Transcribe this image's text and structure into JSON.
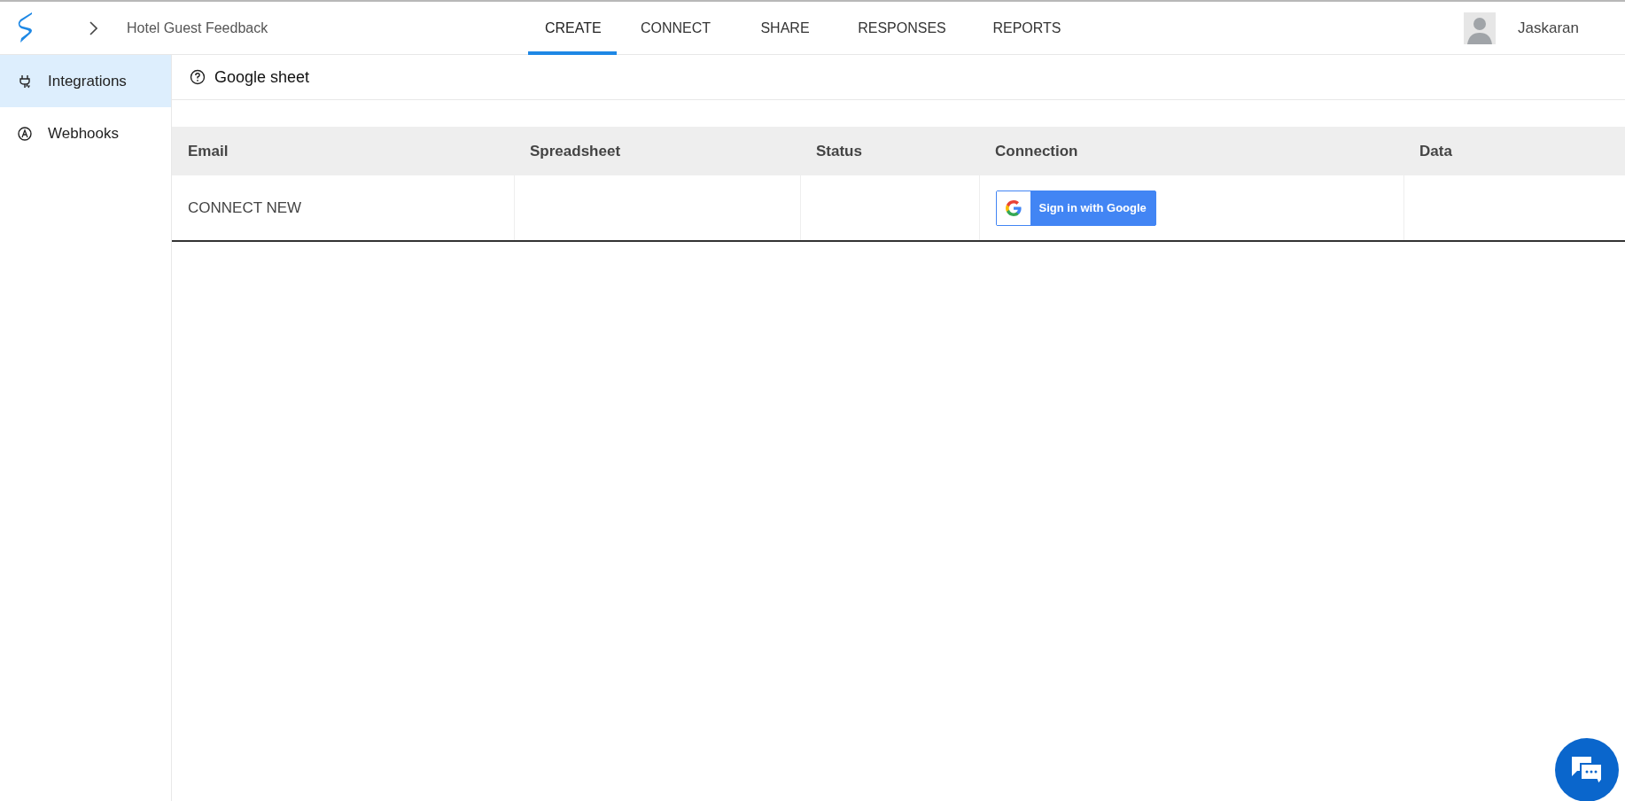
{
  "header": {
    "form_title": "Hotel Guest Feedback",
    "tabs": [
      {
        "label": "CREATE",
        "selected": true
      },
      {
        "label": "CONNECT",
        "selected": false
      },
      {
        "label": "SHARE",
        "selected": false
      },
      {
        "label": "RESPONSES",
        "selected": false
      },
      {
        "label": "REPORTS",
        "selected": false
      }
    ],
    "user_name": "Jaskaran"
  },
  "sidebar": {
    "items": [
      {
        "label": "Integrations",
        "kind": "plug",
        "selected": true
      },
      {
        "label": "Webhooks",
        "kind": "webhook",
        "selected": false
      }
    ]
  },
  "section_title": "Google sheet",
  "table": {
    "columns": [
      "Email",
      "Spreadsheet",
      "Status",
      "Connection",
      "Data"
    ],
    "rows": [
      {
        "email": "CONNECT NEW",
        "spreadsheet": "",
        "status": "",
        "connection_button": "Sign in with Google",
        "data": ""
      }
    ]
  }
}
